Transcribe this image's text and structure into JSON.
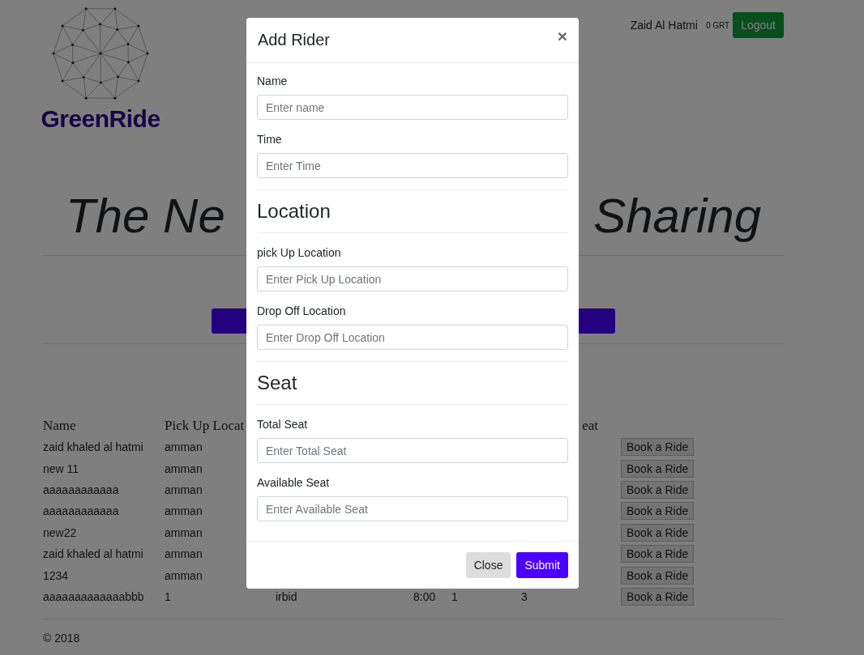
{
  "header": {
    "brand": "GreenRide",
    "user": "Zaid Al Hatmi",
    "balance": "0 GRT",
    "logout": "Logout"
  },
  "hero": {
    "title_left": "The Ne",
    "title_right": "Sharing"
  },
  "table": {
    "columns": [
      "Name",
      "Pick Up Locat",
      null,
      null,
      null,
      "eat",
      null
    ],
    "rows": [
      {
        "cells": [
          "zaid khaled al hatmi",
          "amman",
          null,
          null,
          null,
          null
        ],
        "action": "Book a Ride"
      },
      {
        "cells": [
          "new 11",
          "amman",
          null,
          null,
          null,
          null
        ],
        "action": "Book a Ride"
      },
      {
        "cells": [
          "aaaaaaaaaaaa",
          "amman",
          null,
          null,
          null,
          null
        ],
        "action": "Book a Ride"
      },
      {
        "cells": [
          "aaaaaaaaaaaa",
          "amman",
          null,
          null,
          null,
          null
        ],
        "action": "Book a Ride"
      },
      {
        "cells": [
          "new22",
          "amman",
          null,
          null,
          null,
          null
        ],
        "action": "Book a Ride"
      },
      {
        "cells": [
          "zaid khaled al hatmi",
          "amman",
          null,
          null,
          null,
          null
        ],
        "action": "Book a Ride"
      },
      {
        "cells": [
          "1234",
          "amman",
          null,
          null,
          null,
          null
        ],
        "action": "Book a Ride"
      },
      {
        "cells": [
          "aaaaaaaaaaaaabbb",
          "1",
          "irbid",
          "8:00",
          "1",
          "3"
        ],
        "action": "Book a Ride"
      }
    ]
  },
  "footer": {
    "copyright": "© 2018"
  },
  "modal": {
    "title": "Add Rider",
    "close_icon": "×",
    "sections": [
      {
        "kind": "fields",
        "fields": [
          {
            "label": "Name",
            "placeholder": "Enter name"
          },
          {
            "label": "Time",
            "placeholder": "Enter Time"
          }
        ]
      },
      {
        "kind": "group",
        "heading": "Location",
        "fields": [
          {
            "label": "pick Up Location",
            "placeholder": "Enter Pick Up Location"
          },
          {
            "label": "Drop Off Location",
            "placeholder": "Enter Drop Off Location"
          }
        ]
      },
      {
        "kind": "group",
        "heading": "Seat",
        "fields": [
          {
            "label": "Total Seat",
            "placeholder": "Enter Total Seat"
          },
          {
            "label": "Available Seat",
            "placeholder": "Enter Available Seat"
          }
        ]
      }
    ],
    "buttons": [
      {
        "kind": "secondary",
        "label": "Close"
      },
      {
        "kind": "primary",
        "label": "Submit"
      }
    ]
  }
}
